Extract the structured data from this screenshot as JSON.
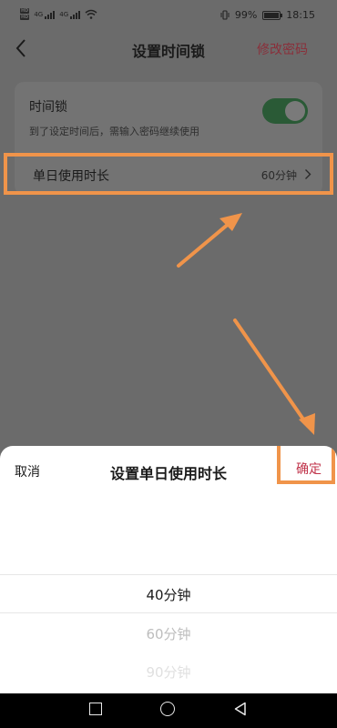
{
  "status_bar": {
    "hd_badges": [
      "HD",
      "HD"
    ],
    "net_labels": [
      "4G",
      "4G"
    ],
    "battery_percent": "99%",
    "battery_level": 0.99,
    "time": "18:15",
    "icons": [
      "signal-icon",
      "wifi-icon",
      "vibrate-icon",
      "battery-icon"
    ]
  },
  "nav": {
    "title": "设置时间锁",
    "action": "修改密码"
  },
  "time_lock": {
    "title": "时间锁",
    "description": "到了设定时间后，需输入密码继续使用",
    "toggle_on": true
  },
  "daily_duration": {
    "label": "单日使用时长",
    "value": "60分钟"
  },
  "sheet": {
    "cancel": "取消",
    "title": "设置单日使用时长",
    "confirm": "确定",
    "options": [
      "40分钟",
      "60分钟",
      "90分钟"
    ],
    "selected": "40分钟"
  },
  "colors": {
    "accent_red": "#c0334a",
    "highlight_orange": "#f0944a",
    "toggle_green": "#2a5a36"
  }
}
